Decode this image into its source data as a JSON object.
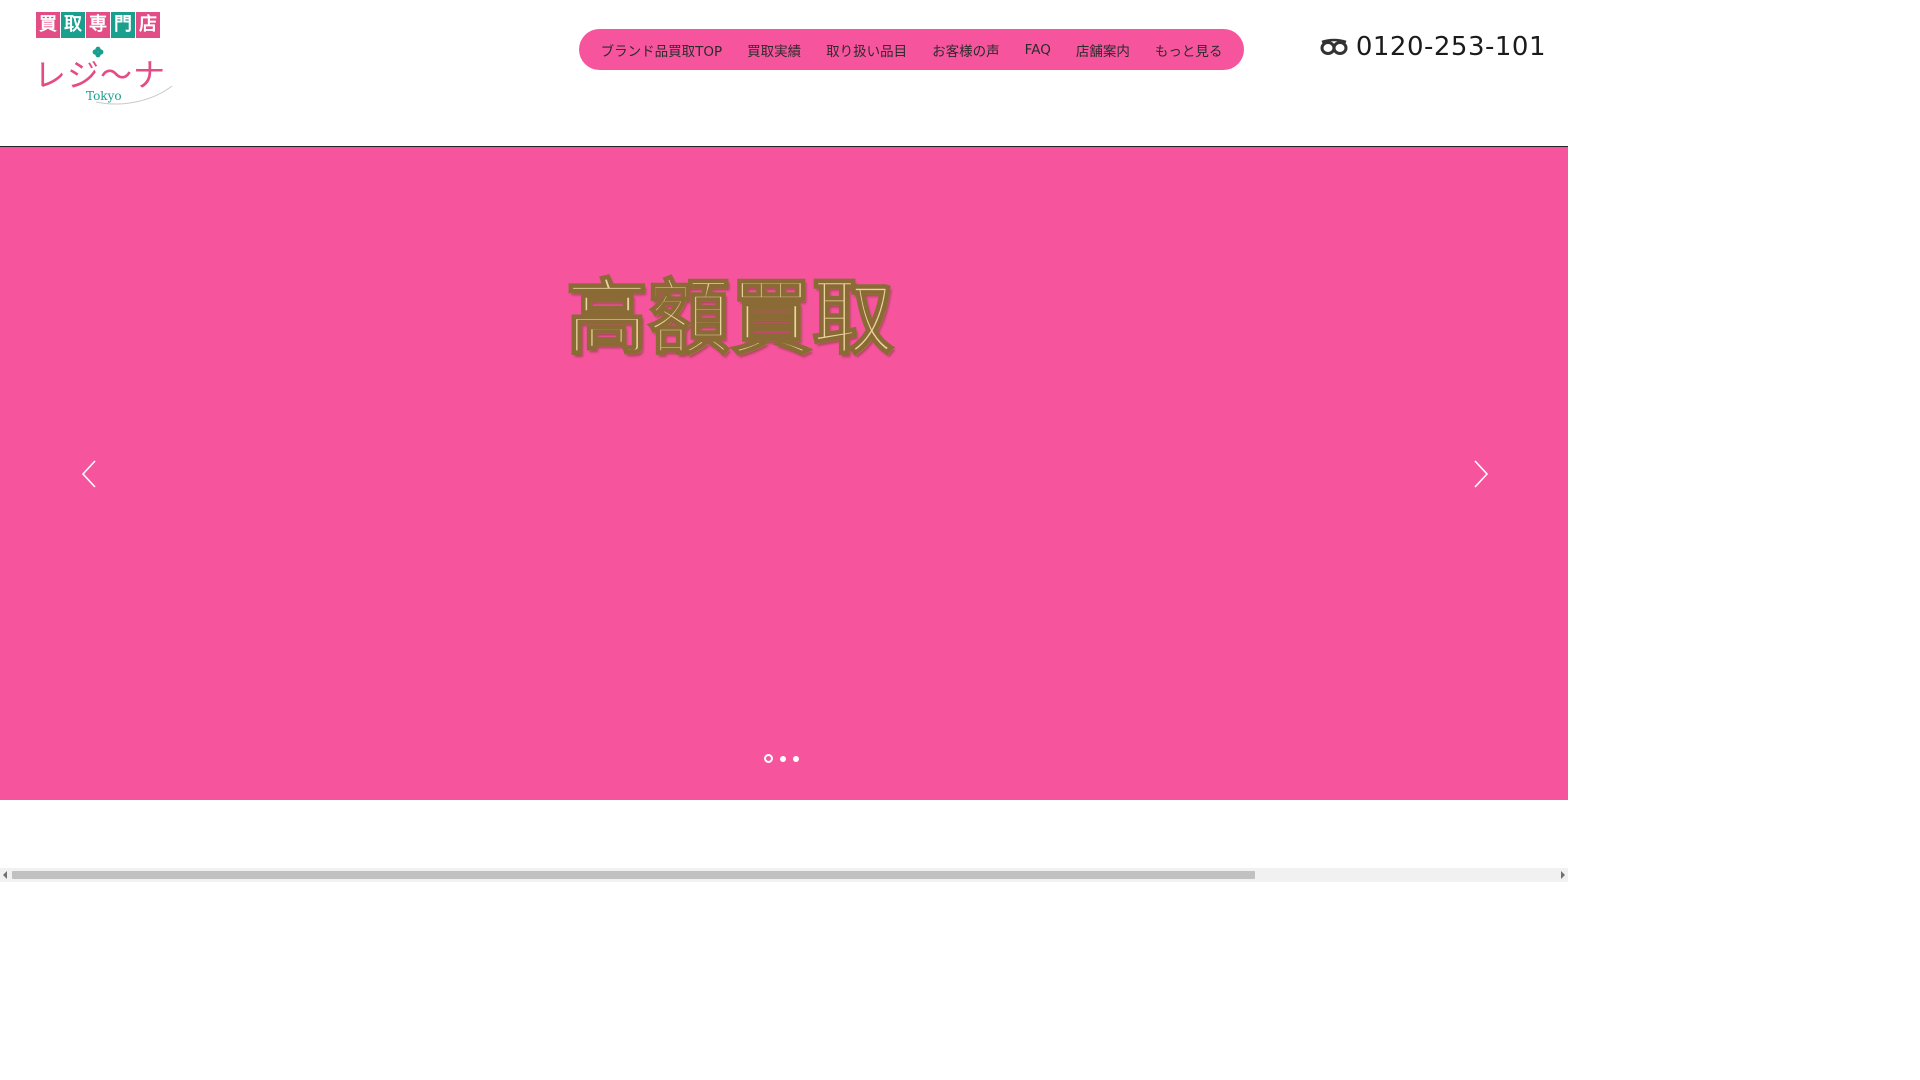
{
  "header": {
    "logo": {
      "badges": [
        "買",
        "取",
        "専",
        "門",
        "店"
      ],
      "name": "レジ〜ナ",
      "sub": "Tokyo"
    },
    "nav": {
      "items": [
        {
          "label": "ブランド品買取TOP"
        },
        {
          "label": "買取実績"
        },
        {
          "label": "取り扱い品目"
        },
        {
          "label": "お客様の声"
        },
        {
          "label": "FAQ"
        },
        {
          "label": "店舗案内"
        },
        {
          "label": "もっと見る"
        }
      ]
    },
    "phone": {
      "icon": "freedial-icon",
      "number": "0120-253-101"
    }
  },
  "hero": {
    "title": "高額買取",
    "slide_count": 3,
    "active_slide": 1,
    "prev_icon": "chevron-left-icon",
    "next_icon": "chevron-right-icon"
  },
  "colors": {
    "brand_pink": "#f6559e",
    "logo_pink": "#e24d86",
    "logo_teal": "#1a9e8e",
    "hero_title_gold": "#ead39f"
  }
}
